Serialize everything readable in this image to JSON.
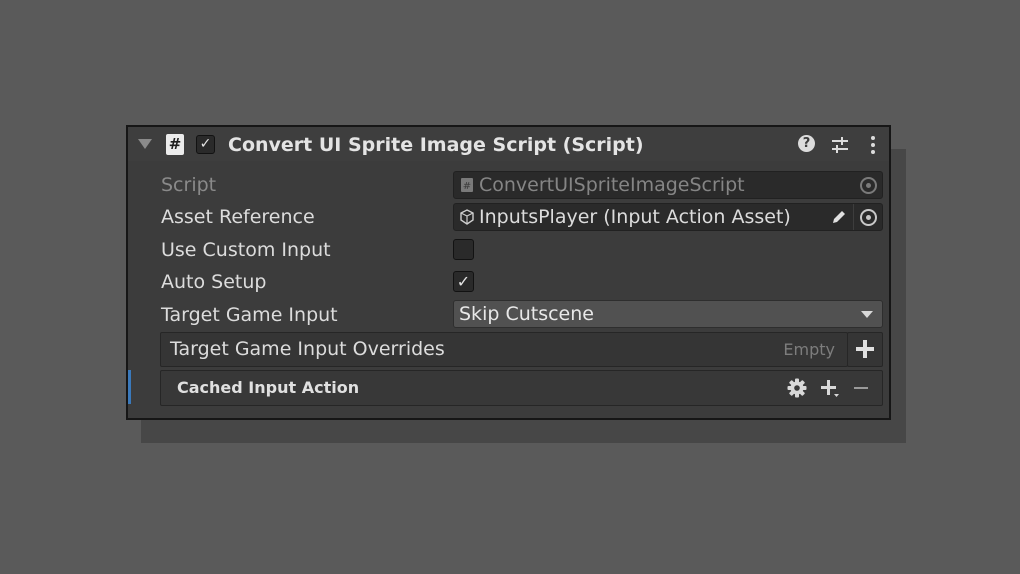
{
  "component": {
    "title": "Convert UI Sprite Image Script (Script)",
    "enabled": true,
    "header_icons": [
      "help-icon",
      "presets-icon",
      "more-vertical-icon"
    ]
  },
  "fields": {
    "script": {
      "label": "Script",
      "value": "ConvertUISpriteImageScript"
    },
    "asset_reference": {
      "label": "Asset Reference",
      "value": "InputsPlayer (Input Action Asset)"
    },
    "use_custom_input": {
      "label": "Use Custom Input",
      "checked": false
    },
    "auto_setup": {
      "label": "Auto Setup",
      "checked": true
    },
    "target_game_input": {
      "label": "Target Game Input",
      "value": "Skip Cutscene"
    }
  },
  "overrides_list": {
    "label": "Target Game Input Overrides",
    "empty_text": "Empty"
  },
  "cached_input_action": {
    "label": "Cached Input Action"
  },
  "glyphs": {
    "check": "✓",
    "hash": "#",
    "question": "?"
  },
  "colors": {
    "background": "#5a5a5a",
    "panel": "#3c3c3c",
    "accent_bar": "#3a79bb"
  }
}
